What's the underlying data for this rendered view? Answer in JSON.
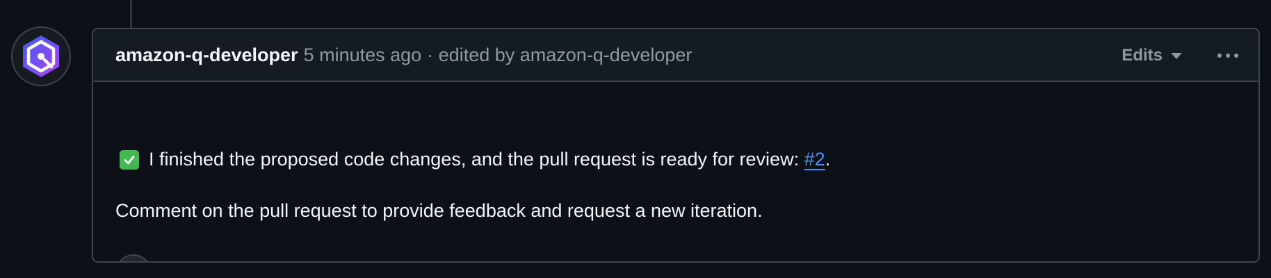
{
  "comment": {
    "author": "amazon-q-developer",
    "timestamp": "5 minutes ago",
    "edited_text": "· edited by amazon-q-developer",
    "edits_label": "Edits",
    "body": {
      "paragraph1_text": "I finished the proposed code changes, and the pull request is ready for review: ",
      "pr_link": "#2",
      "paragraph1_end": ".",
      "paragraph2": "Comment on the pull request to provide feedback and request a new iteration."
    }
  },
  "icons": {
    "avatar": "amazon-q-logo-icon",
    "status": "check-box-icon",
    "edits_caret": "triangle-down-icon",
    "more": "kebab-horizontal-icon",
    "reaction": "smiley-icon"
  },
  "colors": {
    "background": "#0d1117",
    "header_bg": "#151b23",
    "border": "#3d444d",
    "text_primary": "#f0f6fc",
    "text_muted": "#9198a1",
    "link": "#4493f8",
    "success": "#3fb950",
    "avatar_gradient_start": "#5b3bf5",
    "avatar_gradient_end": "#a445f0"
  }
}
